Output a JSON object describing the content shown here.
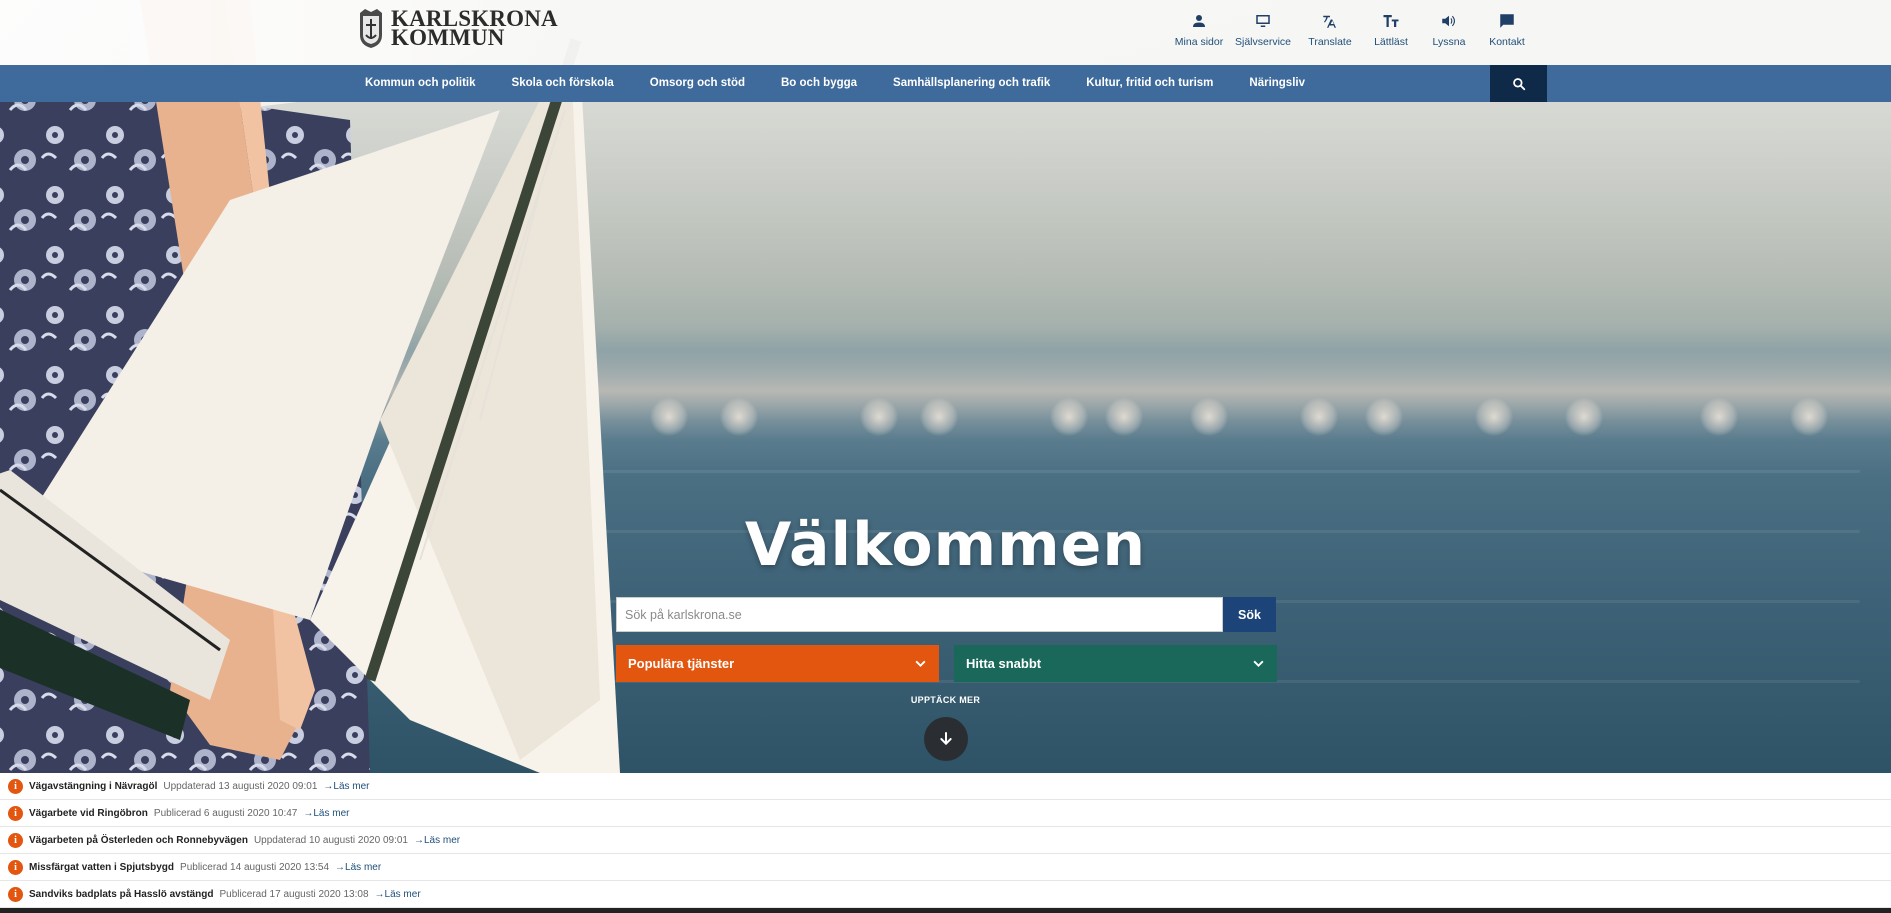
{
  "header": {
    "logo_line1": "KARLSKRONA",
    "logo_line2": "KOMMUN",
    "links": [
      {
        "icon": "person-icon",
        "label": "Mina sidor"
      },
      {
        "icon": "monitor-icon",
        "label": "Självservice"
      },
      {
        "icon": "translate-icon",
        "label": "Translate"
      },
      {
        "icon": "text-size-icon",
        "label": "Lättläst"
      },
      {
        "icon": "speaker-icon",
        "label": "Lyssna"
      },
      {
        "icon": "chat-icon",
        "label": "Kontakt"
      }
    ]
  },
  "nav": {
    "items": [
      "Kommun och politik",
      "Skola och förskola",
      "Omsorg och stöd",
      "Bo och bygga",
      "Samhällsplanering och trafik",
      "Kultur, fritid och turism",
      "Näringsliv"
    ],
    "search_icon": "search-icon"
  },
  "hero": {
    "title": "Välkommen",
    "search_placeholder": "Sök på karlskrona.se",
    "search_button": "Sök",
    "popular_label": "Populära tjänster",
    "find_label": "Hitta snabbt",
    "discover_label": "UPPTÄCK MER"
  },
  "notices": [
    {
      "title": "Vägavstängning i Nävragöl",
      "date": "Uppdaterad 13 augusti 2020 09:01",
      "link": "Läs mer"
    },
    {
      "title": "Vägarbete vid Ringöbron",
      "date": "Publicerad 6 augusti 2020 10:47",
      "link": "Läs mer"
    },
    {
      "title": "Vägarbeten på Österleden och Ronnebyvägen",
      "date": "Uppdaterad 10 augusti 2020 09:01",
      "link": "Läs mer"
    },
    {
      "title": "Missfärgat vatten i Spjutsbygd",
      "date": "Publicerad 14 augusti 2020 13:54",
      "link": "Läs mer"
    },
    {
      "title": "Sandviks badplats på Hasslö avstängd",
      "date": "Publicerad 17 augusti 2020 13:08",
      "link": "Läs mer"
    }
  ],
  "colors": {
    "nav_blue": "#3e6b9b",
    "nav_search_dark": "#0f2a48",
    "search_button_blue": "#1c4478",
    "popular_orange": "#e2560f",
    "find_green": "#19685a"
  }
}
